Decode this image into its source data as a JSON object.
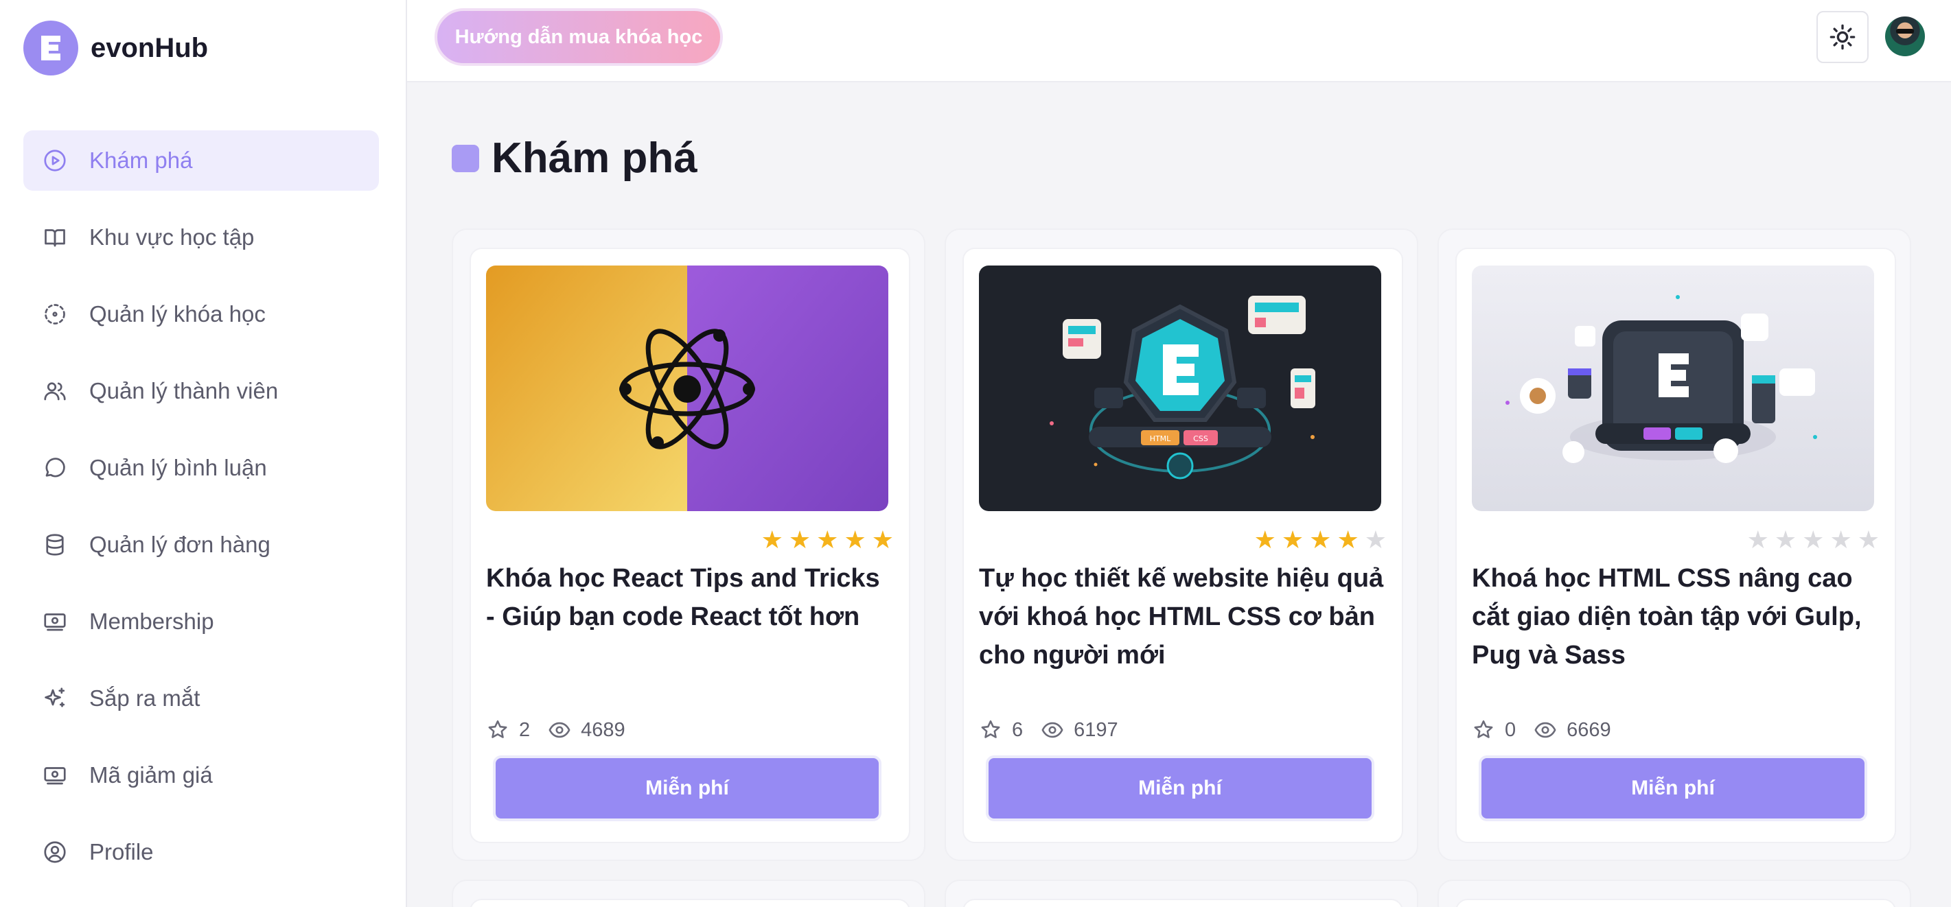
{
  "brand": {
    "name": "evonHub"
  },
  "sidebar": {
    "items": [
      {
        "label": "Khám phá",
        "icon": "play-circle-icon",
        "active": true
      },
      {
        "label": "Khu vực học tập",
        "icon": "book-icon"
      },
      {
        "label": "Quản lý khóa học",
        "icon": "focus-dashed-icon"
      },
      {
        "label": "Quản lý thành viên",
        "icon": "users-icon"
      },
      {
        "label": "Quản lý bình luận",
        "icon": "chat-bubble-icon"
      },
      {
        "label": "Quản lý đơn hàng",
        "icon": "database-icon"
      },
      {
        "label": "Membership",
        "icon": "banknote-icon"
      },
      {
        "label": "Sắp ra mắt",
        "icon": "sparkles-icon"
      },
      {
        "label": "Mã giảm giá",
        "icon": "banknote-icon"
      },
      {
        "label": "Profile",
        "icon": "user-circle-icon"
      }
    ]
  },
  "header": {
    "guide_button": "Hướng dẫn mua khóa học",
    "theme_icon": "sun-icon",
    "avatar_icon": "user-avatar"
  },
  "main": {
    "title": "Khám phá",
    "courses": [
      {
        "title": "Khóa học React Tips and Tricks - Giúp bạn code React tốt hơn",
        "rating": 5,
        "stars_count": "2",
        "views": "4689",
        "price_label": "Miễn phí"
      },
      {
        "title": "Tự học thiết kế website hiệu quả với khoá học HTML CSS cơ bản cho người mới",
        "rating": 4,
        "stars_count": "6",
        "views": "6197",
        "price_label": "Miễn phí"
      },
      {
        "title": "Khoá học HTML CSS nâng cao cắt giao diện toàn tập với Gulp, Pug và Sass",
        "rating": 0,
        "stars_count": "0",
        "views": "6669",
        "price_label": "Miễn phí"
      }
    ]
  },
  "colors": {
    "accent": "#968af3",
    "star": "#f5b31b",
    "active_bg": "#efedfd"
  }
}
